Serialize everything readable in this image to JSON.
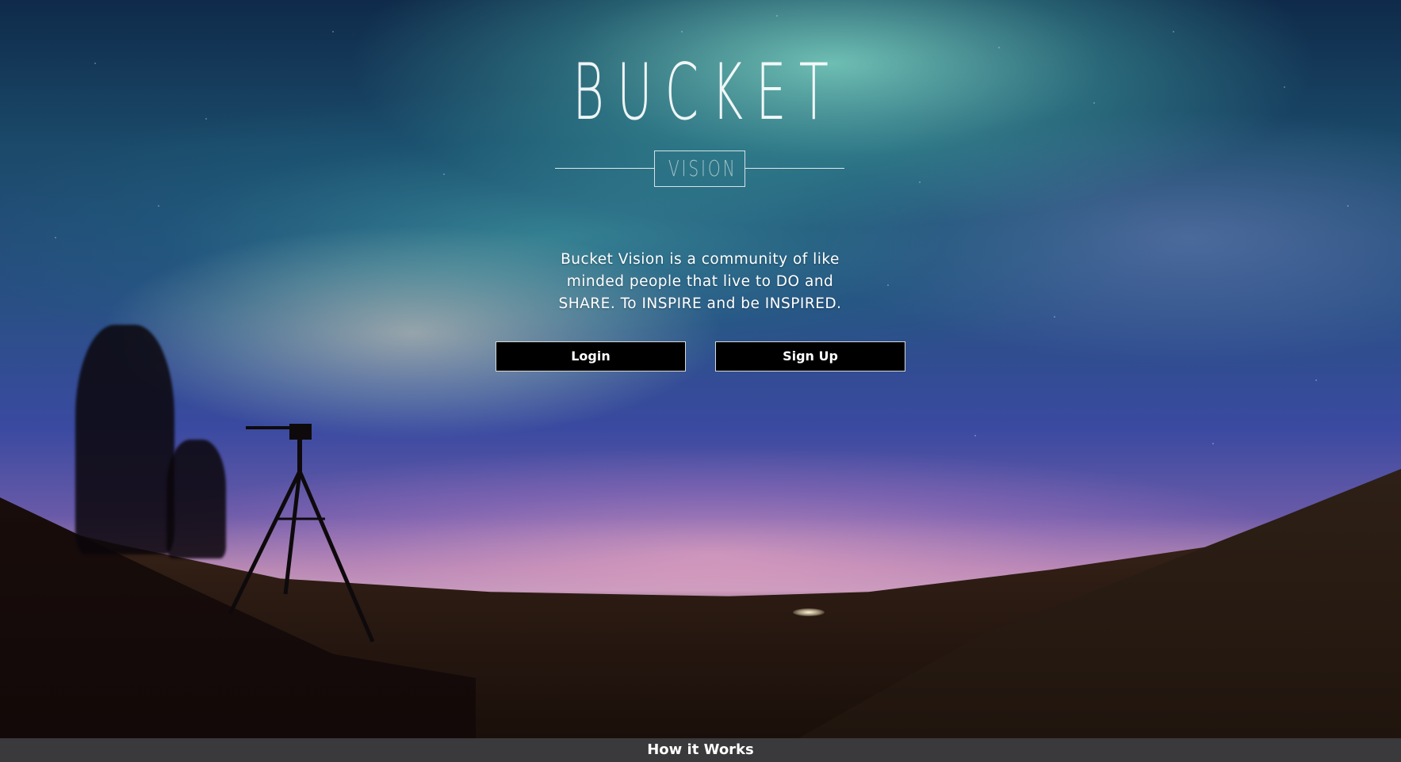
{
  "logo": {
    "title": "BUCKET",
    "subtitle": "VISION"
  },
  "hero": {
    "tagline": "Bucket Vision is a community of like minded people that live to DO and SHARE. To INSPIRE and be INSPIRED."
  },
  "buttons": {
    "login_label": "Login",
    "signup_label": "Sign Up"
  },
  "footer": {
    "how_it_works_label": "How it Works"
  },
  "colors": {
    "button_bg": "#000000",
    "button_border": "#ffffff",
    "footer_bg": "#3a3a3c",
    "text": "#ffffff"
  }
}
